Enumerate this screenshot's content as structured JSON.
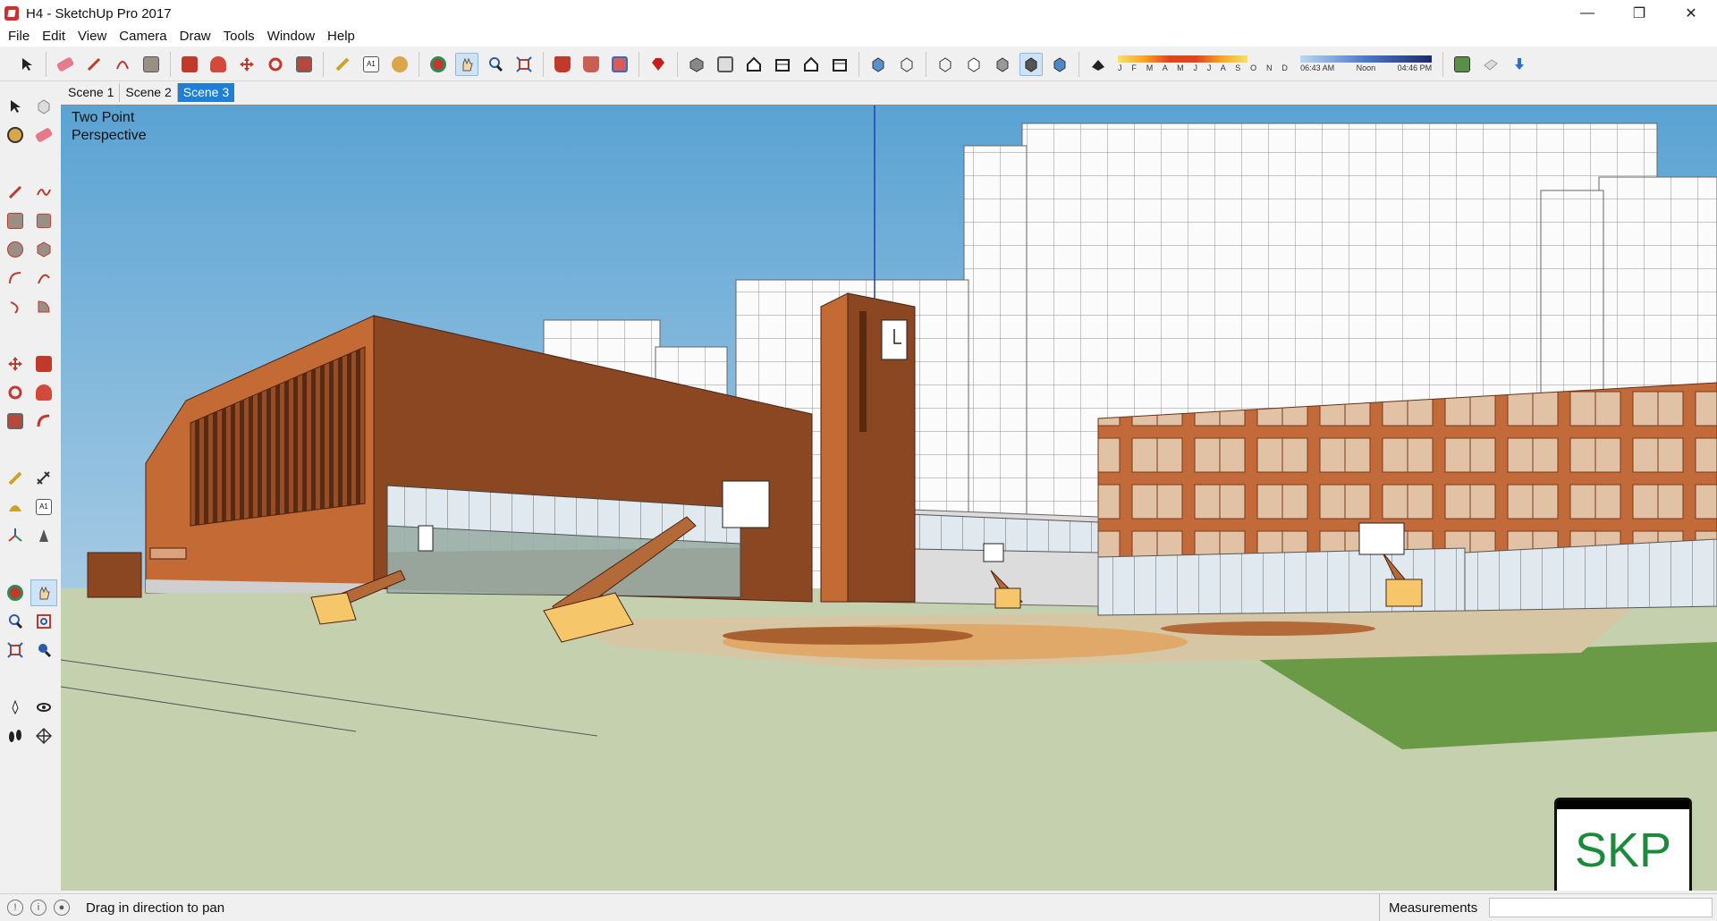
{
  "window": {
    "title": "H4 - SketchUp Pro 2017",
    "controls": {
      "minimize": "—",
      "restore": "❐",
      "close": "✕"
    }
  },
  "menu": [
    "File",
    "Edit",
    "View",
    "Camera",
    "Draw",
    "Tools",
    "Window",
    "Help"
  ],
  "toolbar": {
    "icons": [
      "select-icon",
      "eraser-icon",
      "line-icon",
      "arc-icon",
      "rectangle-icon",
      "push-pull-icon",
      "follow-me-icon",
      "move-icon",
      "rotate-icon",
      "scale-icon",
      "tape-measure-icon",
      "text-icon",
      "paint-bucket-icon",
      "orbit-icon",
      "pan-icon",
      "zoom-icon",
      "zoom-extents-icon",
      "warehouse-icon",
      "extension-icon",
      "send-to-layout-icon",
      "ruby-icon",
      "iso-view-icon",
      "top-view-icon",
      "front-view-icon",
      "right-view-icon",
      "back-view-icon",
      "left-view-icon",
      "xray-icon",
      "back-edges-icon",
      "wireframe-icon",
      "hidden-line-icon",
      "shaded-icon",
      "shaded-textures-icon",
      "monochrome-icon",
      "shadows-toggle-icon"
    ],
    "shadow_months": "J F M A M J J A S O N D",
    "shadow_time_start": "06:43 AM",
    "shadow_time_mid": "Noon",
    "shadow_time_end": "04:46 PM",
    "extra_icons": [
      "add-location-icon",
      "photo-texture-icon",
      "geo-import-icon"
    ]
  },
  "scenes": [
    {
      "label": "Scene 1",
      "active": false
    },
    {
      "label": "Scene 2",
      "active": false
    },
    {
      "label": "Scene 3",
      "active": true
    }
  ],
  "left_tools": [
    "select-icon",
    "make-component-icon",
    "paint-bucket-icon",
    "eraser-icon",
    "line-icon",
    "freehand-icon",
    "rectangle-icon",
    "rotated-rectangle-icon",
    "circle-icon",
    "polygon-icon",
    "arc-icon",
    "two-point-arc-icon",
    "three-point-arc-icon",
    "pie-icon",
    "move-icon",
    "push-pull-icon",
    "rotate-icon",
    "follow-me-icon",
    "scale-icon",
    "offset-icon",
    "tape-measure-icon",
    "dimension-icon",
    "protractor-icon",
    "text-icon",
    "axes-icon",
    "3d-text-icon",
    "orbit-icon",
    "pan-icon",
    "zoom-icon",
    "zoom-window-icon",
    "zoom-extents-icon",
    "previous-view-icon",
    "position-camera-icon",
    "look-around-icon",
    "walk-icon",
    "section-plane-icon"
  ],
  "viewport": {
    "label_line1": "Two Point",
    "label_line2": "Perspective",
    "badge": "SKP",
    "colors": {
      "sky": "#5fa7d4",
      "brick": "#b5642e",
      "brick_dark": "#8a4722",
      "ground": "#c8d3b0",
      "court": "#e0a869",
      "grass": "#6a9a46"
    }
  },
  "status": {
    "message": "Drag in direction to pan",
    "measurements_label": "Measurements",
    "measurements_value": ""
  }
}
